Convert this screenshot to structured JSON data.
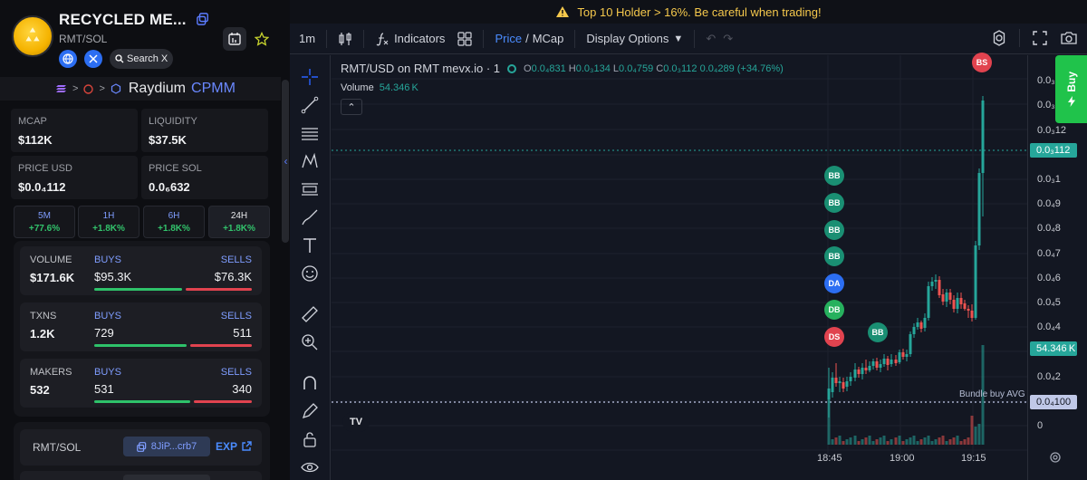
{
  "token": {
    "name": "RECYCLED ME...",
    "pair": "RMT/SOL",
    "search_label": "Search X",
    "route_dex": "Raydium",
    "route_dex_sub": "CPMM"
  },
  "stats": {
    "mcap": {
      "label": "MCAP",
      "value": "$112K"
    },
    "liquidity": {
      "label": "LIQUIDITY",
      "value": "$37.5K"
    },
    "price_usd": {
      "label": "PRICE USD",
      "value": "$0.0₄112"
    },
    "price_sol": {
      "label": "PRICE SOL",
      "value": "0.0₆632"
    }
  },
  "timeframes": [
    {
      "label": "5M",
      "change": "+77.6%"
    },
    {
      "label": "1H",
      "change": "+1.8K%"
    },
    {
      "label": "6H",
      "change": "+1.8K%"
    },
    {
      "label": "24H",
      "change": "+1.8K%"
    }
  ],
  "rows": {
    "volume": {
      "label": "VOLUME",
      "value": "$171.6K",
      "buys_label": "BUYS",
      "buys": "$95.3K",
      "sells_label": "SELLS",
      "sells": "$76.3K",
      "buy_fraction": 0.555
    },
    "txns": {
      "label": "TXNS",
      "value": "1.2K",
      "buys_label": "BUYS",
      "buys": "729",
      "sells_label": "SELLS",
      "sells": "511",
      "buy_fraction": 0.588
    },
    "makers": {
      "label": "MAKERS",
      "value": "532",
      "buys_label": "BUYS",
      "buys": "531",
      "sells_label": "SELLS",
      "sells": "340",
      "buy_fraction": 0.61
    }
  },
  "address": {
    "pair": "RMT/SOL",
    "short": "8JiP...crb7",
    "explorer": "EXP"
  },
  "warning": "Top 10 Holder > 16%. Be careful when trading!",
  "toolbar": {
    "interval": "1m",
    "indicators": "Indicators",
    "price": "Price",
    "slash": "/",
    "mcap": "MCap",
    "display_options": "Display Options"
  },
  "chart_legend": {
    "symbol": "RMT/USD on RMT mevx.io · 1",
    "o_label": "O",
    "o": "0.0₄831",
    "h_label": "H",
    "h": "0.0₃134",
    "l_label": "L",
    "l": "0.0₄759",
    "c_label": "C",
    "c": "0.0₃112",
    "change": "0.0₄289 (+34.76%)",
    "volume_label": "Volume",
    "volume": "54.346 K"
  },
  "price_scale": {
    "labels": [
      "0.0₃",
      "0.0₃",
      "0.0₃12",
      "0.0₃1",
      "0.0₄9",
      "0.0₄8",
      "0.0₄7",
      "0.0₄6",
      "0.0₄5",
      "0.0₄4",
      "0.0₄2",
      "0"
    ],
    "last_price_tag": "0.0₃112",
    "volume_tag": "54.346 K",
    "bundle_tag": "0.0₄100",
    "colors": {
      "up": "#26a69a",
      "down": "#ef5350",
      "bundle": "#c0c8e8"
    }
  },
  "bundle_label": "Bundle buy AVG",
  "time_labels": [
    "18:45",
    "19:00",
    "19:15"
  ],
  "markers": [
    "BB",
    "BB",
    "BB",
    "BB",
    "DA",
    "DB",
    "DS",
    "BB",
    "BS"
  ],
  "buy_tab": "Buy",
  "chart_data": {
    "type": "candlestick",
    "title": "RMT/USD on RMT mevx.io · 1",
    "x": [
      "18:45",
      "19:00",
      "19:15"
    ],
    "ylabel": "",
    "notes": "Single 1m candlestick chart with volume; price spikes from ~0.00002 to ~0.000112 around 19:15."
  }
}
